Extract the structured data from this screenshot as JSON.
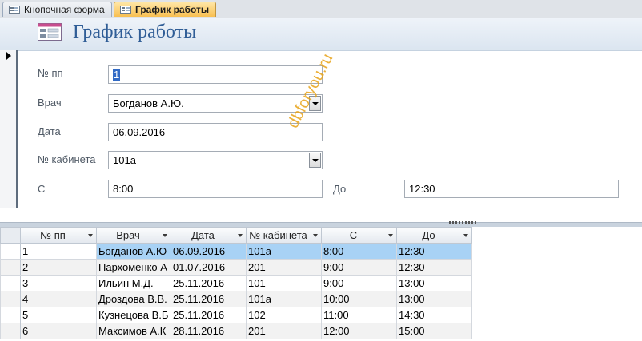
{
  "tabs": [
    {
      "label": "Кнопочная форма",
      "active": false
    },
    {
      "label": "График работы",
      "active": true
    }
  ],
  "form": {
    "title": "График работы",
    "fields": {
      "pp": {
        "label": "№ пп",
        "value": "1"
      },
      "doctor": {
        "label": "Врач",
        "value": "Богданов А.Ю."
      },
      "date": {
        "label": "Дата",
        "value": "06.09.2016"
      },
      "cabinet": {
        "label": "№ кабинета",
        "value": "101а"
      },
      "from": {
        "label": "С",
        "value": "8:00"
      },
      "to": {
        "label": "До",
        "value": "12:30"
      }
    },
    "watermark": "dbforyou.ru"
  },
  "datasheet": {
    "columns": [
      "№ пп",
      "Врач",
      "Дата",
      "№ кабинета",
      "С",
      "До"
    ],
    "rows": [
      [
        "1",
        "Богданов А.Ю",
        "06.09.2016",
        "101а",
        "8:00",
        "12:30"
      ],
      [
        "2",
        "Пархоменко А",
        "01.07.2016",
        "201",
        "9:00",
        "12:30"
      ],
      [
        "3",
        "Ильин М.Д.",
        "25.11.2016",
        "101",
        "9:00",
        "13:00"
      ],
      [
        "4",
        "Дроздова В.В.",
        "25.11.2016",
        "101а",
        "10:00",
        "13:00"
      ],
      [
        "5",
        "Кузнецова В.Б",
        "25.11.2016",
        "102",
        "11:00",
        "14:30"
      ],
      [
        "6",
        "Максимов А.К",
        "28.11.2016",
        "201",
        "12:00",
        "15:00"
      ]
    ]
  },
  "colors": {
    "accent_title": "#2f5d96",
    "current_row": "#a8d2f5",
    "active_tab": "#f8bf51",
    "watermark": "#e8a317"
  }
}
